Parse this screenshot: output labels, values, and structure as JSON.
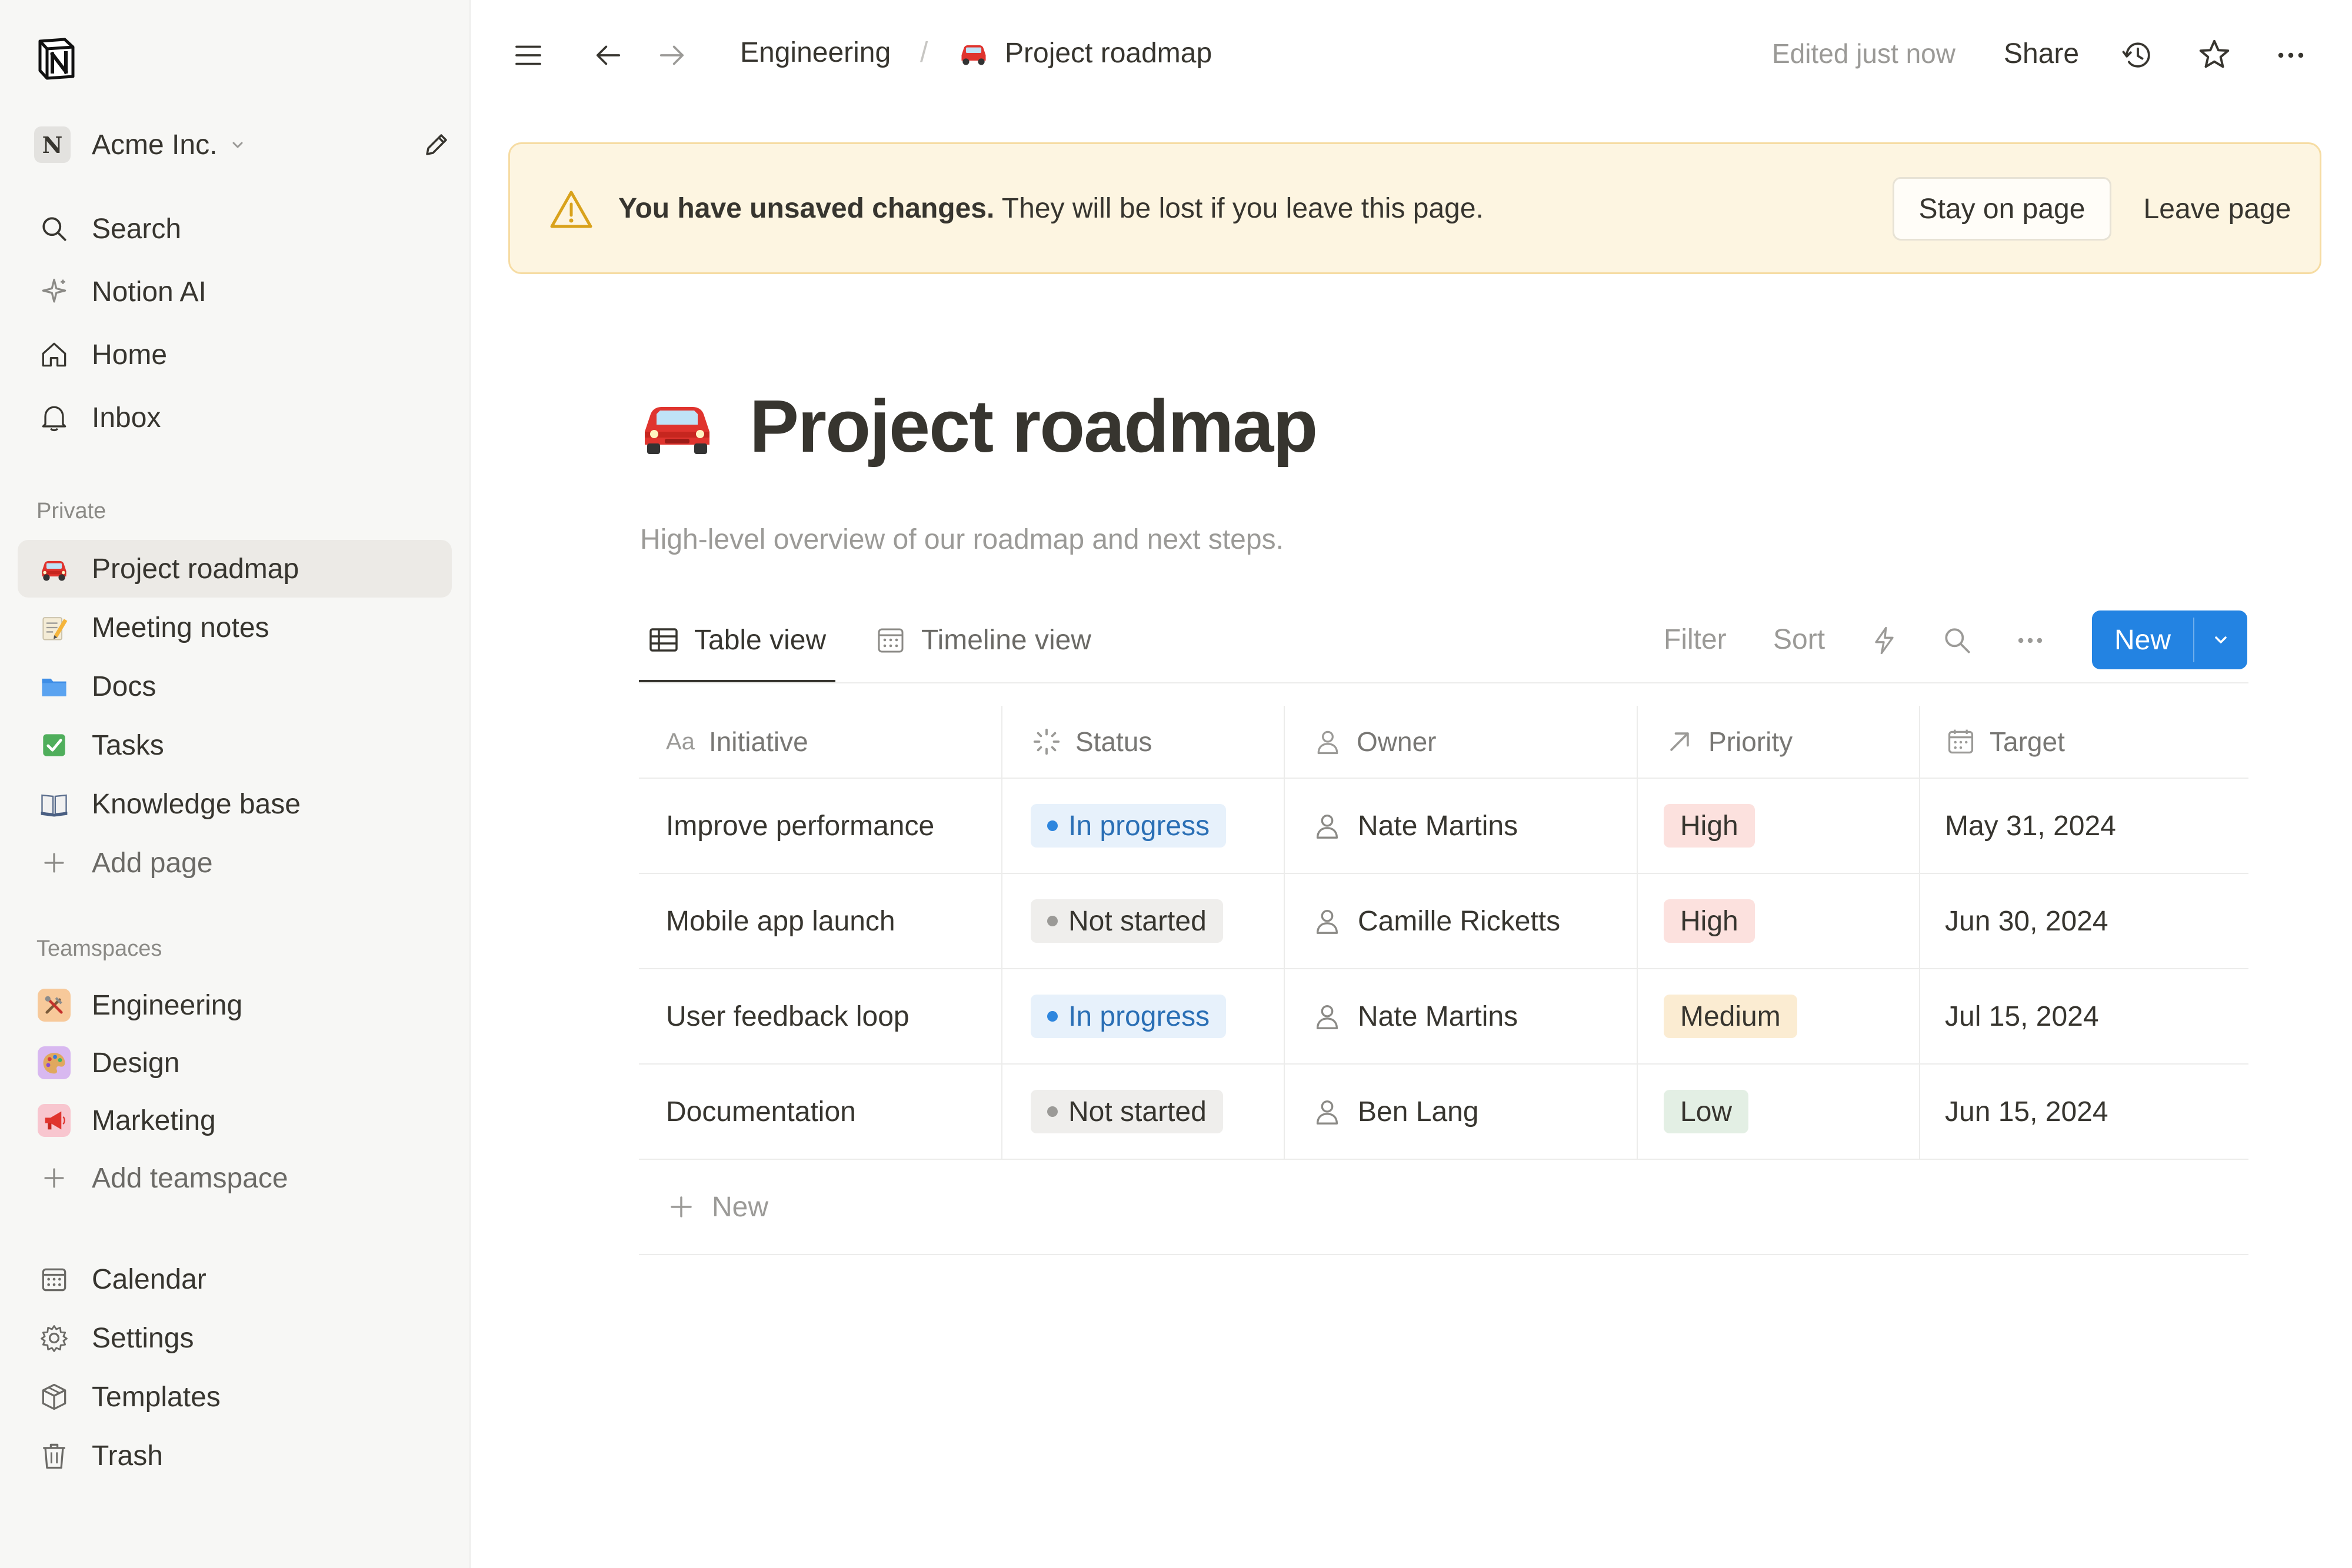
{
  "sidebar": {
    "workspace": {
      "badge": "N",
      "name": "Acme Inc."
    },
    "nav": [
      {
        "label": "Search",
        "icon": "search-icon"
      },
      {
        "label": "Notion AI",
        "icon": "sparkle-icon"
      },
      {
        "label": "Home",
        "icon": "home-icon"
      },
      {
        "label": "Inbox",
        "icon": "bell-icon"
      }
    ],
    "private_label": "Private",
    "private": [
      {
        "label": "Project roadmap",
        "icon": "car-emoji-icon",
        "active": true
      },
      {
        "label": "Meeting notes",
        "icon": "memo-emoji-icon"
      },
      {
        "label": "Docs",
        "icon": "folder-emoji-icon"
      },
      {
        "label": "Tasks",
        "icon": "checkbox-emoji-icon"
      },
      {
        "label": "Knowledge base",
        "icon": "book-emoji-icon"
      },
      {
        "label": "Add page",
        "icon": "plus-icon"
      }
    ],
    "teamspaces_label": "Teamspaces",
    "teamspaces": [
      {
        "label": "Engineering",
        "icon": "tools-emoji-icon",
        "tile_color": "#f7c99a"
      },
      {
        "label": "Design",
        "icon": "palette-emoji-icon",
        "tile_color": "#d8b8f0"
      },
      {
        "label": "Marketing",
        "icon": "megaphone-emoji-icon",
        "tile_color": "#f8c6cf"
      },
      {
        "label": "Add teamspace",
        "icon": "plus-icon"
      }
    ],
    "bottom": [
      {
        "label": "Calendar",
        "icon": "calendar-icon"
      },
      {
        "label": "Settings",
        "icon": "gear-icon"
      },
      {
        "label": "Templates",
        "icon": "cube-icon"
      },
      {
        "label": "Trash",
        "icon": "trash-icon"
      }
    ]
  },
  "topbar": {
    "breadcrumb": [
      "Engineering",
      "Project roadmap"
    ],
    "breadcrumb_separator": "/",
    "edited": "Edited just now",
    "share": "Share"
  },
  "banner": {
    "bold": "You have unsaved changes.",
    "text": " They will be lost if you leave this page.",
    "stay": "Stay on page",
    "leave": "Leave page",
    "colors": {
      "background": "#fdf5e1",
      "border": "#f6dca3",
      "icon": "#d9a21b"
    }
  },
  "page": {
    "title": "Project roadmap",
    "description": "High-level overview of our roadmap and next steps."
  },
  "views": {
    "tabs": [
      {
        "label": "Table view",
        "icon": "table-icon",
        "active": true
      },
      {
        "label": "Timeline view",
        "icon": "calendar-icon"
      }
    ],
    "tools": {
      "filter": "Filter",
      "sort": "Sort"
    },
    "new_button": "New",
    "accent": "#2383e2"
  },
  "table": {
    "columns": [
      {
        "label": "Initiative",
        "icon": "text-property-icon",
        "glyph": "Aa"
      },
      {
        "label": "Status",
        "icon": "status-icon"
      },
      {
        "label": "Owner",
        "icon": "person-icon"
      },
      {
        "label": "Priority",
        "icon": "arrow-up-right-icon"
      },
      {
        "label": "Target",
        "icon": "calendar-icon"
      }
    ],
    "rows": [
      {
        "initiative": "Improve performance",
        "status": "In progress",
        "owner": "Nate Martins",
        "priority": "High",
        "target": "May 31, 2024"
      },
      {
        "initiative": "Mobile app launch",
        "status": "Not started",
        "owner": "Camille Ricketts",
        "priority": "High",
        "target": "Jun 30, 2024"
      },
      {
        "initiative": "User feedback loop",
        "status": "In progress",
        "owner": "Nate Martins",
        "priority": "Medium",
        "target": "Jul 15, 2024"
      },
      {
        "initiative": "Documentation",
        "status": "Not started",
        "owner": "Ben Lang",
        "priority": "Low",
        "target": "Jun 15, 2024"
      }
    ],
    "new_row": "New",
    "status_colors": {
      "In progress": {
        "bg": "#e7f1fb",
        "fg": "#2a6fb5",
        "dot": "#2e86de"
      },
      "Not started": {
        "bg": "#efeeec",
        "fg": "#37352f",
        "dot": "#9b9a97"
      }
    },
    "priority_colors": {
      "High": {
        "bg": "#fce1de",
        "fg": "#37352f"
      },
      "Medium": {
        "bg": "#fbecd2",
        "fg": "#37352f"
      },
      "Low": {
        "bg": "#e3efe4",
        "fg": "#37352f"
      }
    }
  }
}
